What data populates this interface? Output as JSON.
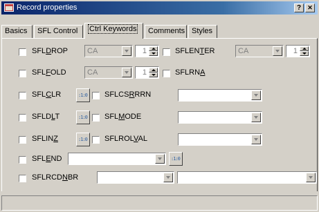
{
  "window": {
    "title": "Record properties",
    "help_button": "?",
    "close_button": "✕"
  },
  "tabs": [
    {
      "label": "Basics",
      "active": false
    },
    {
      "label": "SFL Control",
      "active": false
    },
    {
      "label": "Ctrl Keywords",
      "active": true
    },
    {
      "label": "Comments",
      "active": false
    },
    {
      "label": "Styles",
      "active": false
    }
  ],
  "keywords": {
    "sfldrop": {
      "pre": "SFL",
      "mn": "D",
      "post": "ROP",
      "combo": "CA",
      "spin": "1"
    },
    "sfllenter": {
      "pre": "SFLEN",
      "mn": "T",
      "post": "ER",
      "combo": "CA",
      "spin": "1"
    },
    "sflfold": {
      "pre": "SFL",
      "mn": "F",
      "post": "OLD",
      "combo": "CA",
      "spin": "1"
    },
    "sflrna": {
      "pre": "SFLRN",
      "mn": "A",
      "post": ""
    },
    "sflclr": {
      "pre": "SFL",
      "mn": "C",
      "post": "LR"
    },
    "sflcsrrrn": {
      "pre": "SFLCS",
      "mn": "R",
      "post": "RRN",
      "combo": ""
    },
    "sfldlt": {
      "pre": "SFLD",
      "mn": "L",
      "post": "T"
    },
    "sflmode": {
      "pre": "SFL",
      "mn": "M",
      "post": "ODE",
      "combo": ""
    },
    "sflinz": {
      "pre": "SFLIN",
      "mn": "Z",
      "post": ""
    },
    "sflrolval": {
      "pre": "SFLROL",
      "mn": "V",
      "post": "AL",
      "combo": ""
    },
    "sflend": {
      "pre": "SFL",
      "mn": "E",
      "post": "ND",
      "combo": ""
    },
    "sflrcdnbr": {
      "pre": "SFLRCD",
      "mn": "N",
      "post": "BR",
      "combo1": "",
      "combo2": ""
    }
  },
  "picker_icon": "indicator-picker-icon",
  "colors": {
    "face": "#d4d0c8",
    "title_start": "#0a246a",
    "title_end": "#a6caf0"
  }
}
